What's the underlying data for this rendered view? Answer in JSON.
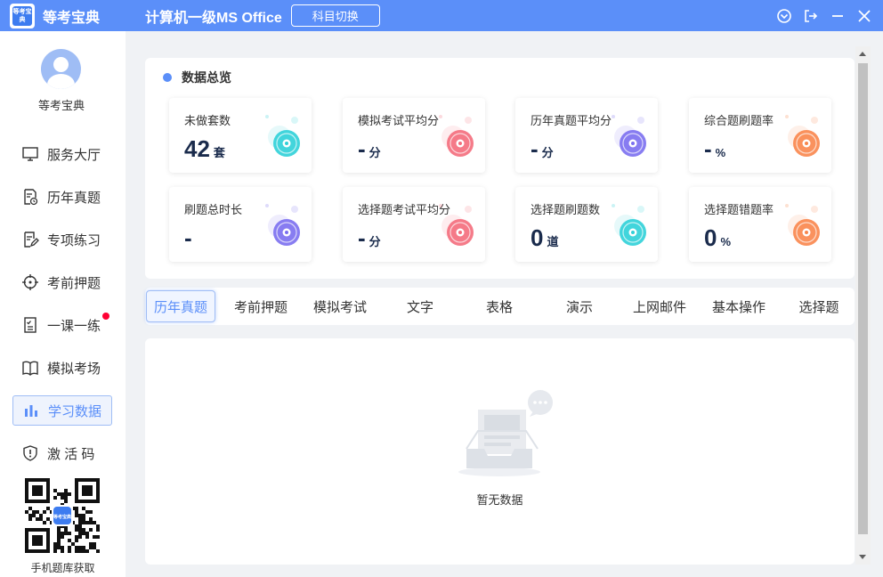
{
  "titlebar": {
    "logo_text": "等考宝典",
    "brand": "等考宝典",
    "subject": "计算机一级MS Office",
    "switch_label": "科目切换"
  },
  "sidebar": {
    "username": "等考宝典",
    "items": [
      {
        "label": "服务大厅",
        "icon": "monitor-icon"
      },
      {
        "label": "历年真题",
        "icon": "document-clock-icon"
      },
      {
        "label": "专项练习",
        "icon": "edit-document-icon"
      },
      {
        "label": "考前押题",
        "icon": "crosshair-icon"
      },
      {
        "label": "一课一练",
        "icon": "checklist-icon",
        "has_badge": true
      },
      {
        "label": "模拟考场",
        "icon": "book-icon"
      },
      {
        "label": "学习数据",
        "icon": "bar-chart-icon",
        "active": true
      },
      {
        "label": "激 活 码",
        "icon": "shield-icon"
      }
    ],
    "qr_caption": "手机题库获取",
    "qr_logo_text": "等考宝典"
  },
  "overview": {
    "title": "数据总览",
    "stats": [
      {
        "label": "未做套数",
        "value": "42",
        "unit": "套",
        "color": "#2fd0d8"
      },
      {
        "label": "模拟考试平均分",
        "value": "-",
        "unit": "分",
        "color": "#f46d7c"
      },
      {
        "label": "历年真题平均分",
        "value": "-",
        "unit": "分",
        "color": "#7b6ff0"
      },
      {
        "label": "综合题刷题率",
        "value": "-",
        "unit": "%",
        "color": "#f9864c"
      },
      {
        "label": "刷题总时长",
        "value": "-",
        "unit": "",
        "color": "#7b6ff0"
      },
      {
        "label": "选择题考试平均分",
        "value": "-",
        "unit": "分",
        "color": "#f46d7c"
      },
      {
        "label": "选择题刷题数",
        "value": "0",
        "unit": "道",
        "color": "#2fd0d8"
      },
      {
        "label": "选择题错题率",
        "value": "0",
        "unit": "%",
        "color": "#f9864c"
      }
    ]
  },
  "tabs": [
    "历年真题",
    "考前押题",
    "模拟考试",
    "文字",
    "表格",
    "演示",
    "上网邮件",
    "基本操作",
    "选择题"
  ],
  "active_tab": 0,
  "empty": {
    "text": "暂无数据"
  }
}
